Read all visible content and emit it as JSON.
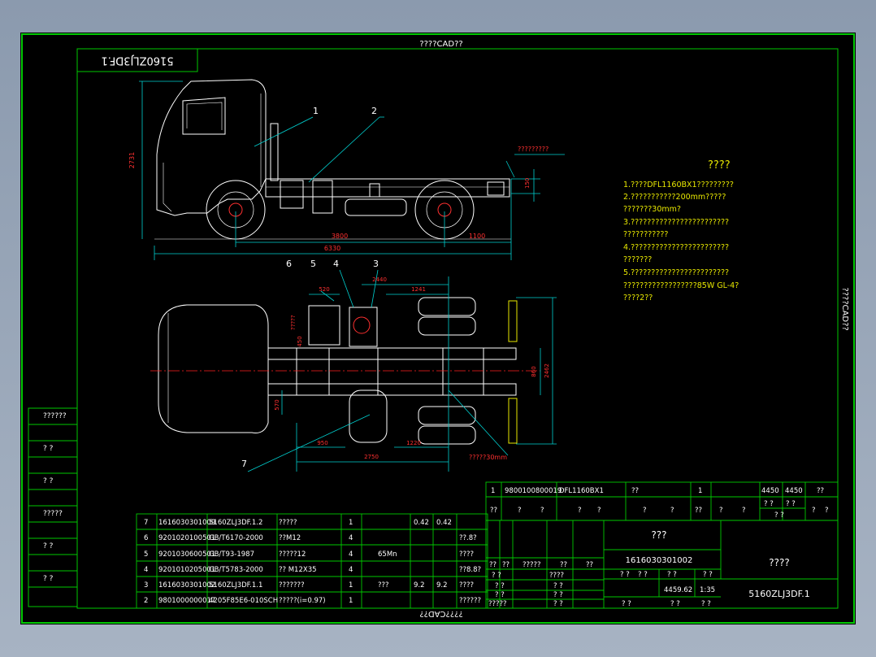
{
  "frame": {
    "top_label": "????CAD??",
    "bottom_label": "????CAD??",
    "right_label": "????CAD??",
    "corner_title": "5160ZLJ3DF.1"
  },
  "left_stamp": [
    "??????",
    "? ?",
    "? ?",
    "?????",
    "? ?",
    "? ?"
  ],
  "callouts": [
    "1",
    "2",
    "3",
    "4",
    "5",
    "6",
    "7"
  ],
  "side_view": {
    "total_height": "2731",
    "wheelbase": "3800",
    "overall_length": "6330",
    "rear_overhang": "1100",
    "tail_label": "?????????",
    "tail_dim": "150"
  },
  "top_view": {
    "dim_1": "520",
    "dim_2": "2440",
    "dim_3": "1241",
    "dim_4": "450",
    "dim_5": "950",
    "dim_6": "2750",
    "dim_7": "1220",
    "dim_8": "860",
    "dim_9": "2462",
    "dim_10": "570",
    "note_30mm": "?????30mm",
    "vertical_note": "?????"
  },
  "notes": {
    "title": "????",
    "lines": [
      "1.????DFL1160BX1?????????",
      "2.???????????200mm?????",
      "  ???????30mm?",
      "3.????????????????????????",
      "  ???????????",
      "4.????????????????????????",
      "  ???????",
      "5.????????????????????????",
      "  ??????????????????85W GL-4?",
      "  ????2??"
    ]
  },
  "parts_list": [
    {
      "no": "7",
      "code": "1616030301009",
      "std": "5160ZLJ3DF.1.2",
      "name": "?????",
      "qty": "1",
      "mat": "",
      "w1": "0.42",
      "w2": "0.42",
      "note": ""
    },
    {
      "no": "6",
      "code": "9201020100501",
      "std": "GB/T6170-2000",
      "name": "??M12",
      "qty": "4",
      "mat": "",
      "w1": "",
      "w2": "",
      "note": "??.8?"
    },
    {
      "no": "5",
      "code": "9201030600501",
      "std": "GB/T93-1987",
      "name": "?????12",
      "qty": "4",
      "mat": "65Mn",
      "w1": "",
      "w2": "",
      "note": "????"
    },
    {
      "no": "4",
      "code": "9201010205001",
      "std": "GB/T5783-2000",
      "name": "?? M12X35",
      "qty": "4",
      "mat": "",
      "w1": "",
      "w2": "",
      "note": "??8.8?"
    },
    {
      "no": "3",
      "code": "1616030301002",
      "std": "5160ZLJ3DF.1.1",
      "name": "???????",
      "qty": "1",
      "mat": "???",
      "w1": "9.2",
      "w2": "9.2",
      "note": "????"
    },
    {
      "no": "2",
      "code": "9801000000017",
      "std": "4205F85E6-010SCH",
      "name": "?????(i=0.97)",
      "qty": "1",
      "mat": "",
      "w1": "",
      "w2": "",
      "note": "??????"
    }
  ],
  "title_block": {
    "row1": [
      "1",
      "9800100800019",
      "DFL1160BX1",
      "??",
      "1",
      "",
      "4450",
      "4450",
      "??"
    ],
    "row2": [
      "??",
      "?",
      "?",
      "?",
      "?",
      "?",
      "?",
      "??",
      "?",
      "?",
      "? ?",
      "? ?",
      "? ?",
      "?",
      "?"
    ],
    "drawing_no": "1616030301002",
    "name": "???",
    "unit": "????",
    "model": "5160ZLJ3DF.1",
    "weight": "4459.62",
    "scale": "1:35",
    "row_a": [
      "??",
      "??",
      "?????",
      "??",
      "??"
    ],
    "row_b": [
      "? ?",
      "????",
      "? ?"
    ],
    "row_c": [
      "? ?",
      "? ?"
    ],
    "row_d": [
      "? ?",
      "? ?"
    ],
    "row_e": [
      "?????",
      "? ?"
    ],
    "sub_a": [
      "? ?",
      "? ?"
    ],
    "sub_b": [
      "? ?",
      "? ?"
    ],
    "sub_c": [
      "? ?",
      "? ?",
      "? ?"
    ]
  },
  "colors": {
    "frame": "#00c800",
    "drawing": "#ffffff",
    "dimension": "#00d0d0",
    "dim_text": "#ff3030",
    "notes": "#e8e800",
    "centerline": "#ff2020"
  }
}
